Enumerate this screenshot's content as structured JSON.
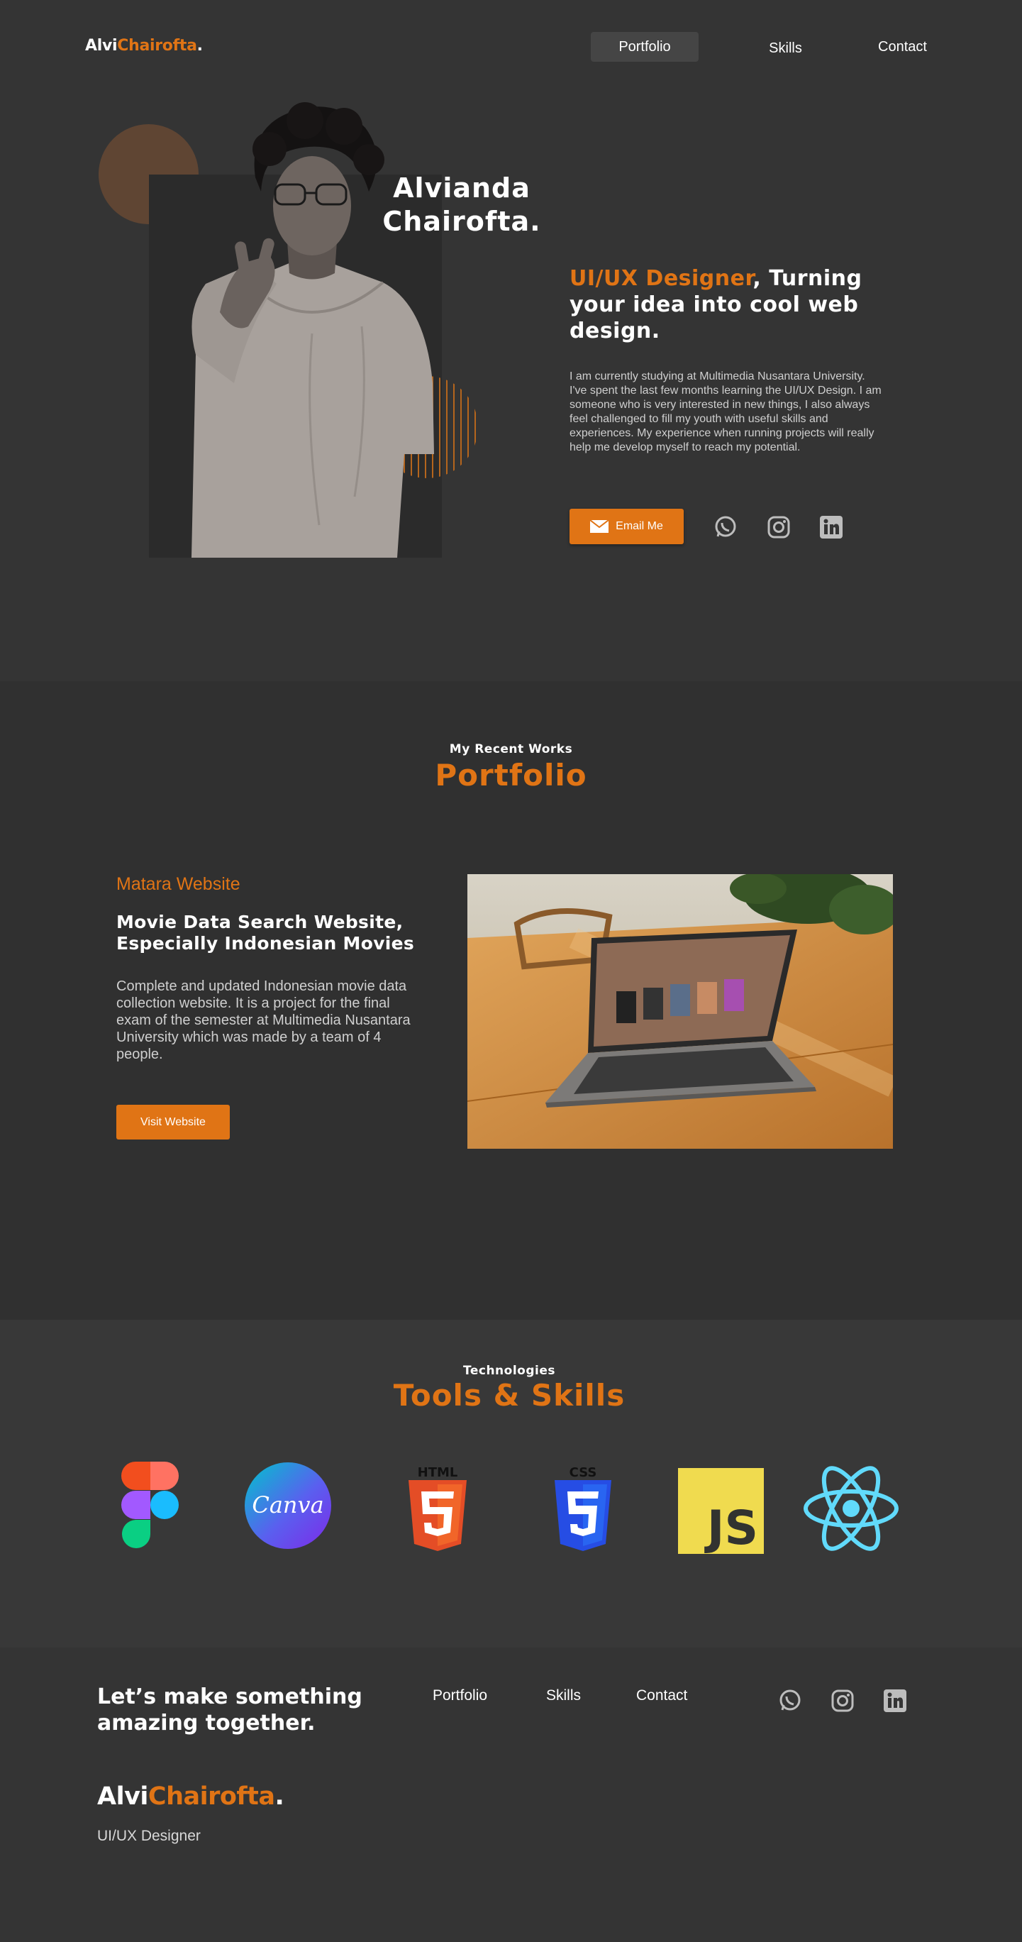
{
  "nav": {
    "logo_first": "Alvi",
    "logo_second": "Chairofta",
    "logo_dot": ".",
    "links": [
      "Portfolio",
      "Skills",
      "Contact"
    ]
  },
  "hero": {
    "name_line1": "Alvianda",
    "name_line2": "Chairofta.",
    "headline_accent": "UI/UX Designer",
    "headline_rest": ", Turning your idea into cool web design.",
    "bio": "I am currently studying at Multimedia Nusantara University. I've spent the last few months learning the UI/UX Design. I am someone who is very interested in new things, I also always feel challenged to fill my youth with useful skills and experiences. My experience when running projects will really help me develop myself to reach my potential.",
    "email_button": "Email Me",
    "socials": [
      "whatsapp-icon",
      "instagram-icon",
      "linkedin-icon"
    ]
  },
  "portfolio": {
    "kicker": "My Recent Works",
    "title": "Portfolio",
    "project": {
      "name": "Matara Website",
      "title": "Movie Data Search Website, Especially Indonesian Movies",
      "description": "Complete and updated Indonesian movie data collection website. It is a project for the final exam of the semester at Multimedia Nusantara University which was made by a team of 4 people.",
      "button": "Visit Website"
    }
  },
  "skills": {
    "kicker": "Technologies",
    "title": "Tools & Skills",
    "items": [
      "figma-icon",
      "canva-icon",
      "html5-icon",
      "css3-icon",
      "javascript-icon",
      "react-icon"
    ],
    "canva_text": "Canva",
    "html_label": "HTML",
    "css_label": "CSS",
    "js_label": "JS"
  },
  "footer": {
    "tagline": "Let’s make something amazing together.",
    "links": [
      "Portfolio",
      "Skills",
      "Contact"
    ],
    "logo_first": "Alvi",
    "logo_second": "Chairofta",
    "logo_dot": ".",
    "role": "UI/UX Designer"
  },
  "colors": {
    "accent": "#E07415",
    "background": "#343434",
    "text": "#FFFFFF"
  }
}
